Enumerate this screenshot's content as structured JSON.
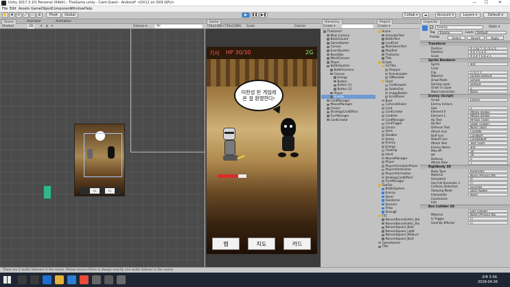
{
  "window": {
    "title": "Unity 2017.3.1f1 Personal (64bit) - TheGame.unity - Card Quest - Android* <DX11 on DX9 GPU>",
    "minimize": "—",
    "maximize": "☐",
    "close": "✕"
  },
  "menu": [
    "File",
    "Edit",
    "Assets",
    "GameObject",
    "Component",
    "Window",
    "Help"
  ],
  "toolbar": {
    "pivot": "Pivot",
    "global": "Global",
    "collab": "Collab ▾",
    "account": "Account ▾",
    "layers": "Layers ▾",
    "layout": "Default ▾"
  },
  "scene_panel": {
    "tabs": [
      "Scene",
      "Animator",
      "Animation"
    ],
    "shaded": "Shaded",
    "mode_2d": "2D",
    "gizmos": "Gizmos ▾",
    "search": "All",
    "buttons": [
      "지도",
      "카드"
    ]
  },
  "game_panel": {
    "tab": "Game",
    "resolution": "720x1280 (720x1280)",
    "scale_label": "Scale",
    "maximize": "Maximize On Play",
    "mute": "Mute Audio",
    "stats": "Stats",
    "gizmos": "Gizmos",
    "hud": {
      "name": "기사",
      "hp": "HP 30/30",
      "gold": "2G"
    },
    "speech": "미완성 된 게임에\n온 걸 환영한다!",
    "buttons": [
      "맵",
      "지도",
      "카드"
    ],
    "colors": {
      "hud_hp": "#ff5a55",
      "hud_gold": "#7dff7d",
      "bg_top": "#8a6431",
      "bg_mid": "#cfb278",
      "bg_low": "#5a3a1e",
      "hp_bar": "#d92c2c"
    }
  },
  "hierarchy": {
    "tab": "Hierarchy",
    "create": "Create ▾",
    "items": [
      {
        "label": "TheGame*",
        "depth": 0,
        "icon": "unity",
        "selected": false
      },
      {
        "label": "Main Camera",
        "depth": 1,
        "icon": "go"
      },
      {
        "label": "BackGround",
        "depth": 1,
        "icon": "go"
      },
      {
        "label": "GameStarter",
        "depth": 1,
        "icon": "go"
      },
      {
        "label": "Canvas",
        "depth": 1,
        "icon": "go"
      },
      {
        "label": "EventSystem",
        "depth": 1,
        "icon": "go"
      },
      {
        "label": "BlockBox",
        "depth": 1,
        "icon": "go"
      },
      {
        "label": "WorldCanvas",
        "depth": 1,
        "icon": "go"
      },
      {
        "label": "Player",
        "depth": 1,
        "icon": "go"
      },
      {
        "label": "BattleSystem",
        "depth": 1,
        "icon": "go"
      },
      {
        "label": "BattleCamera",
        "depth": 2,
        "icon": "go"
      },
      {
        "label": "Canvas",
        "depth": 2,
        "icon": "go"
      },
      {
        "label": "Energy",
        "depth": 3,
        "icon": "go"
      },
      {
        "label": "Button",
        "depth": 3,
        "icon": "go"
      },
      {
        "label": "Button (1)",
        "depth": 3,
        "icon": "go"
      },
      {
        "label": "Button (2)",
        "depth": 3,
        "icon": "go"
      },
      {
        "label": "Player",
        "depth": 2,
        "icon": "go"
      },
      {
        "label": "Enemy",
        "depth": 2,
        "icon": "go",
        "selected": true
      },
      {
        "label": "CardManager",
        "depth": 1,
        "icon": "go"
      },
      {
        "label": "MouseManager",
        "depth": 1,
        "icon": "go"
      },
      {
        "label": "Choice",
        "depth": 1,
        "icon": "go"
      },
      {
        "label": "StrategyCardEffect",
        "depth": 1,
        "icon": "go"
      },
      {
        "label": "TurnManager",
        "depth": 1,
        "icon": "go"
      },
      {
        "label": "CardCreator",
        "depth": 1,
        "icon": "go"
      }
    ]
  },
  "project": {
    "tab": "Project",
    "create": "Create ▾",
    "items": [
      {
        "label": "Scene",
        "depth": 0,
        "icon": "folder"
      },
      {
        "label": "AnimatorTest",
        "depth": 1,
        "icon": "unity"
      },
      {
        "label": "BattleTest",
        "depth": 1,
        "icon": "unity"
      },
      {
        "label": "CardFind",
        "depth": 1,
        "icon": "unity"
      },
      {
        "label": "MainGameTest",
        "depth": 1,
        "icon": "unity"
      },
      {
        "label": "MapTest",
        "depth": 1,
        "icon": "unity"
      },
      {
        "label": "TheGame",
        "depth": 1,
        "icon": "unity"
      },
      {
        "label": "Title",
        "depth": 1,
        "icon": "unity"
      },
      {
        "label": "Scripts",
        "depth": 0,
        "icon": "folder"
      },
      {
        "label": "ForTitle",
        "depth": 1,
        "icon": "folder"
      },
      {
        "label": "Dropper",
        "depth": 2,
        "icon": "script"
      },
      {
        "label": "SceneLoader",
        "depth": 2,
        "icon": "script"
      },
      {
        "label": "UIMonoSet",
        "depth": 2,
        "icon": "script"
      },
      {
        "label": "ForUI",
        "depth": 1,
        "icon": "folder"
      },
      {
        "label": "CardGraphic",
        "depth": 2,
        "icon": "script"
      },
      {
        "label": "FadeInOut",
        "depth": 2,
        "icon": "script"
      },
      {
        "label": "ImageButton",
        "depth": 2,
        "icon": "script"
      },
      {
        "label": "ScrollPanel",
        "depth": 2,
        "icon": "script"
      },
      {
        "label": "Buzz",
        "depth": 1,
        "icon": "script"
      },
      {
        "label": "CameraShaker",
        "depth": 1,
        "icon": "script"
      },
      {
        "label": "Card",
        "depth": 1,
        "icon": "script"
      },
      {
        "label": "CardCreator",
        "depth": 1,
        "icon": "script"
      },
      {
        "label": "CardInfo",
        "depth": 1,
        "icon": "script"
      },
      {
        "label": "CardManager",
        "depth": 1,
        "icon": "script"
      },
      {
        "label": "CardTrigger",
        "depth": 1,
        "icon": "script"
      },
      {
        "label": "Choice",
        "depth": 1,
        "icon": "script"
      },
      {
        "label": "Deck",
        "depth": 1,
        "icon": "script"
      },
      {
        "label": "Disabler",
        "depth": 1,
        "icon": "script"
      },
      {
        "label": "Dump",
        "depth": 1,
        "icon": "script"
      },
      {
        "label": "Enemy",
        "depth": 1,
        "icon": "script"
      },
      {
        "label": "Energy",
        "depth": 1,
        "icon": "script"
      },
      {
        "label": "Floating",
        "depth": 1,
        "icon": "script"
      },
      {
        "label": "Hand",
        "depth": 1,
        "icon": "script"
      },
      {
        "label": "MouseManager",
        "depth": 1,
        "icon": "script"
      },
      {
        "label": "Player",
        "depth": 1,
        "icon": "script"
      },
      {
        "label": "PlayerAnimationPlayer",
        "depth": 1,
        "icon": "script"
      },
      {
        "label": "PlayerInfoInGame",
        "depth": 1,
        "icon": "script"
      },
      {
        "label": "PlayerInformation",
        "depth": 1,
        "icon": "script"
      },
      {
        "label": "StrategyCardEffect",
        "depth": 1,
        "icon": "script"
      },
      {
        "label": "TurnManager",
        "depth": 1,
        "icon": "script"
      },
      {
        "label": "TestFile",
        "depth": 0,
        "icon": "folder"
      },
      {
        "label": "BattleSystem",
        "depth": 1,
        "icon": "blue"
      },
      {
        "label": "Enemy",
        "depth": 1,
        "icon": "blue"
      },
      {
        "label": "Panel",
        "depth": 1,
        "icon": "blue"
      },
      {
        "label": "Randomer",
        "depth": 1,
        "icon": "blue"
      },
      {
        "label": "Recever",
        "depth": 1,
        "icon": "blue"
      },
      {
        "label": "Shop",
        "depth": 1,
        "icon": "blue"
      },
      {
        "label": "StrongE",
        "depth": 1,
        "icon": "blue"
      },
      {
        "label": "TTF",
        "depth": 0,
        "icon": "folder"
      },
      {
        "label": "NanumBarunGothic_Bold",
        "depth": 1,
        "icon": "font"
      },
      {
        "label": "NanumBarunGothic_Regular",
        "depth": 1,
        "icon": "font"
      },
      {
        "label": "NanumSquare_Bold",
        "depth": 1,
        "icon": "font"
      },
      {
        "label": "NanumSquare_Light",
        "depth": 1,
        "icon": "font"
      },
      {
        "label": "NanumSquare_Medium",
        "depth": 1,
        "icon": "font"
      },
      {
        "label": "NanumSquare_Bold",
        "depth": 1,
        "icon": "font"
      },
      {
        "label": "GameStarter",
        "depth": 0,
        "icon": "script"
      },
      {
        "label": "Title",
        "depth": 0,
        "icon": "unity"
      }
    ]
  },
  "inspector": {
    "tab": "Inspector",
    "object_name": "Enemy",
    "static": "Static ▾",
    "tag_label": "Tag",
    "tag": "Enemy",
    "layer_label": "Layer",
    "layer": "Default",
    "prefab_label": "Prefab",
    "prefab_buttons": [
      "Select",
      "Revert",
      "Apply"
    ],
    "rows": [
      {
        "type": "section",
        "label": "Transform"
      },
      {
        "type": "row",
        "key": "Position",
        "value": "X 1.62   Y -0.74   Z 0"
      },
      {
        "type": "row",
        "key": "Rotation",
        "value": "X 0   Y 0   Z 0"
      },
      {
        "type": "row",
        "key": "Scale",
        "value": "X 0.4   Y 0.4   Z 1"
      },
      {
        "type": "section",
        "label": "Sprite Renderer"
      },
      {
        "type": "row",
        "key": "Sprite",
        "value": "흑엽"
      },
      {
        "type": "row",
        "key": "Color",
        "value": ""
      },
      {
        "type": "row",
        "key": "Flip",
        "value": "☐ X  ☐ Y"
      },
      {
        "type": "row",
        "key": "Material",
        "value": "Sprites-Default"
      },
      {
        "type": "row",
        "key": "Draw Mode",
        "value": "Simple"
      },
      {
        "type": "row",
        "key": "Sorting Layer",
        "value": "Default"
      },
      {
        "type": "row",
        "key": "Order in Layer",
        "value": "2"
      },
      {
        "type": "row",
        "key": "Mask Interaction",
        "value": "None"
      },
      {
        "type": "section",
        "label": "Enemy (Script)"
      },
      {
        "type": "row",
        "key": "Script",
        "value": "Enemy"
      },
      {
        "type": "row",
        "key": "Enemy Actions",
        "value": ""
      },
      {
        "type": "row",
        "key": "Size",
        "value": "2"
      },
      {
        "type": "row",
        "key": "Element 0",
        "value": "Attack 4ardEF"
      },
      {
        "type": "row",
        "key": "Element 1",
        "value": "Attack 4ardEF"
      },
      {
        "type": "row",
        "key": "Hp Text",
        "value": "HPText (Text)"
      },
      {
        "type": "row",
        "key": "Hp Bar",
        "value": "Slider (Slider)"
      },
      {
        "type": "row",
        "key": "Defense Text",
        "value": "None (Text)"
      },
      {
        "type": "row",
        "key": "Attack Icon",
        "value": "CardAtk"
      },
      {
        "type": "row",
        "key": "Buff Icon",
        "value": "CardBuff"
      },
      {
        "type": "row",
        "key": "Debuff Icon",
        "value": "CardDebuff"
      },
      {
        "type": "row",
        "key": "Attack Text",
        "value": "Text (Text)"
      },
      {
        "type": "row",
        "key": "Enemy Name",
        "value": "흑엽"
      },
      {
        "type": "row",
        "key": "Max HP",
        "value": "30"
      },
      {
        "type": "row",
        "key": "HP",
        "value": "30"
      },
      {
        "type": "row",
        "key": "Defense",
        "value": "0"
      },
      {
        "type": "row",
        "key": "Attack Rate",
        "value": "7"
      },
      {
        "type": "section",
        "label": "Rigidbody 2D"
      },
      {
        "type": "row",
        "key": "Body Type",
        "value": "Kinematic"
      },
      {
        "type": "row",
        "key": "Material",
        "value": "None (Physics Ma"
      },
      {
        "type": "row",
        "key": "Simulated",
        "value": "☑"
      },
      {
        "type": "row",
        "key": "Use Full Kinematic C",
        "value": "☐"
      },
      {
        "type": "row",
        "key": "Collision Detection",
        "value": "Discrete"
      },
      {
        "type": "row",
        "key": "Sleeping Mode",
        "value": "Start Awake"
      },
      {
        "type": "row",
        "key": "Interpolate",
        "value": "None"
      },
      {
        "type": "row",
        "key": "Constraints",
        "value": ""
      },
      {
        "type": "row",
        "key": "Info",
        "value": ""
      },
      {
        "type": "section",
        "label": "Box Collider 2D"
      },
      {
        "type": "row",
        "key": "",
        "value": "Edit Collider"
      },
      {
        "type": "row",
        "key": "Material",
        "value": "None (Physics Ma"
      },
      {
        "type": "row",
        "key": "Is Trigger",
        "value": "☐"
      },
      {
        "type": "row",
        "key": "Used By Effector",
        "value": "☐"
      }
    ]
  },
  "status": "There are 2 audio listeners in the scene. Please ensure there is always exactly one audio listener in the scene.",
  "taskbar": {
    "time": "오후 5:56",
    "date": "2018-04-26"
  }
}
